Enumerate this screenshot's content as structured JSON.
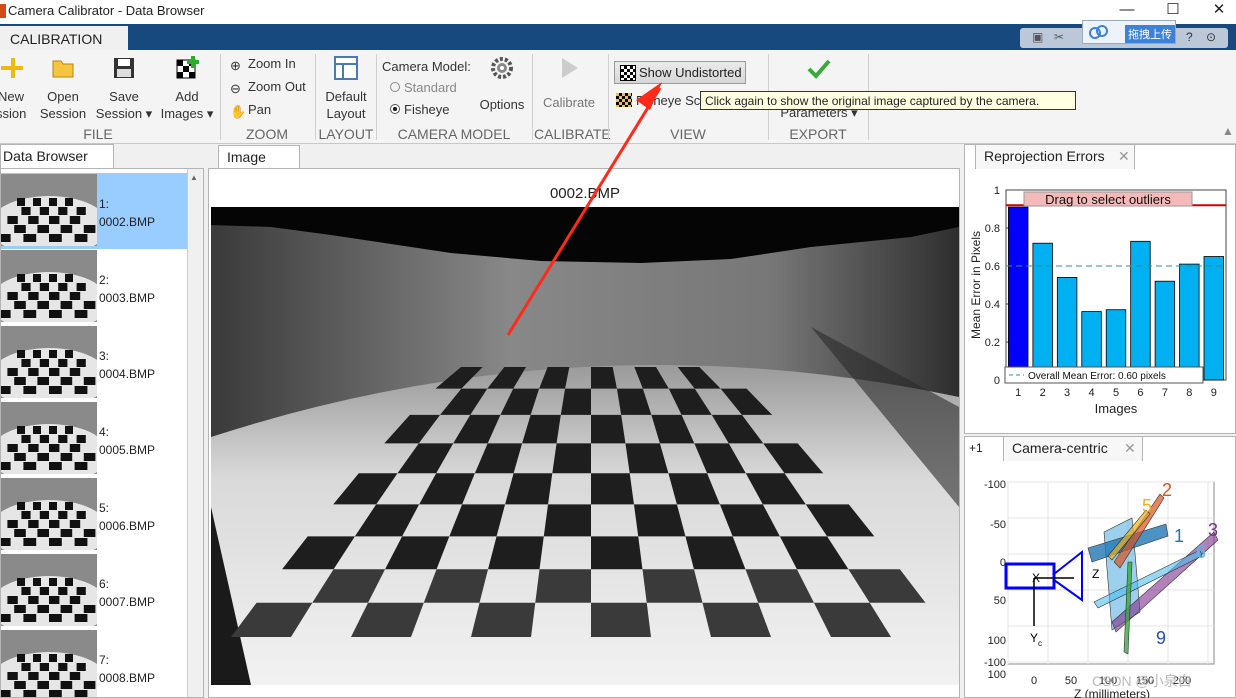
{
  "window": {
    "title": "Camera Calibrator - Data Browser",
    "minimize": "—",
    "maximize": "☐",
    "close": "✕"
  },
  "tabs": {
    "main": "CALIBRATION"
  },
  "upload": {
    "label": "拖拽上传"
  },
  "ribbon": {
    "file": {
      "label": "FILE",
      "new_line1": "New",
      "new_line2": "ssion",
      "open_line1": "Open",
      "open_line2": "Session",
      "save_line1": "Save",
      "save_line2": "Session ▾",
      "add_line1": "Add",
      "add_line2": "Images ▾"
    },
    "zoom": {
      "label": "ZOOM",
      "zoom_in": "Zoom In",
      "zoom_out": "Zoom Out",
      "pan": "Pan"
    },
    "layout": {
      "label": "LAYOUT",
      "default_line1": "Default",
      "default_line2": "Layout"
    },
    "camera_model": {
      "label": "CAMERA MODEL",
      "heading": "Camera Model:",
      "standard": "Standard",
      "fisheye": "Fisheye",
      "options": "Options"
    },
    "calibrate": {
      "label": "CALIBRATE",
      "button": "Calibrate"
    },
    "view": {
      "label": "VIEW",
      "show_undistorted": "Show Undistorted",
      "fisheye_scale": "Fisheye Sca"
    },
    "export": {
      "label": "EXPORT",
      "parameters": "Parameters ▾"
    }
  },
  "tooltip": "Click again to show the original image captured by the camera.",
  "data_browser": {
    "title": "Data Browser",
    "items": [
      {
        "index": "1:",
        "name": "0002.BMP"
      },
      {
        "index": "2:",
        "name": "0003.BMP"
      },
      {
        "index": "3:",
        "name": "0004.BMP"
      },
      {
        "index": "4:",
        "name": "0005.BMP"
      },
      {
        "index": "5:",
        "name": "0006.BMP"
      },
      {
        "index": "6:",
        "name": "0007.BMP"
      },
      {
        "index": "7:",
        "name": "0008.BMP"
      }
    ]
  },
  "image_panel": {
    "tab": "Image",
    "filename": "0002.BMP"
  },
  "reprojection": {
    "tab": "Reprojection Errors",
    "close": "✕",
    "drag_label": "Drag to select outliers",
    "legend": "Overall Mean Error: 0.60 pixels"
  },
  "camera_centric": {
    "tab": "Camera-centric",
    "close": "✕",
    "plus": "+1",
    "xlabel": "Z (millimeters)",
    "xc": "X",
    "yc": "Y",
    "zc": "Z",
    "c_sub": "c"
  },
  "watermark": "CSDN @小泉白",
  "chart_data": [
    {
      "type": "bar",
      "categories": [
        "1",
        "2",
        "3",
        "4",
        "5",
        "6",
        "7",
        "8",
        "9"
      ],
      "values": [
        0.91,
        0.72,
        0.54,
        0.36,
        0.37,
        0.73,
        0.52,
        0.61,
        0.65
      ],
      "xlabel": "Images",
      "ylabel": "Mean Error in Pixels",
      "ylim": [
        0,
        1
      ],
      "yticks": [
        "0",
        "0.2",
        "0.4",
        "0.6",
        "0.8",
        "1"
      ],
      "mean_line": 0.6,
      "threshold_line": 0.92,
      "colors": {
        "bar": "#00b0f0",
        "selected": "#0000ff",
        "threshold": "#d40000"
      }
    },
    {
      "type": "scatter",
      "xlabel": "Z (millimeters)",
      "xticks": [
        "0",
        "50",
        "100",
        "150",
        "200"
      ],
      "yticks": [
        "-100",
        "-50",
        "0",
        "50",
        "100",
        "-100",
        "100"
      ],
      "pattern_labels": [
        "1",
        "2",
        "3",
        "5",
        "6",
        "9"
      ],
      "colors": {
        "camera": "#0000ff",
        "label1": "#1f77b4",
        "label2": "#d9531e",
        "label3": "#7e2f8e",
        "label5": "#edb120",
        "label6": "#4dbeee",
        "label9": "#1f4fbf"
      }
    }
  ]
}
